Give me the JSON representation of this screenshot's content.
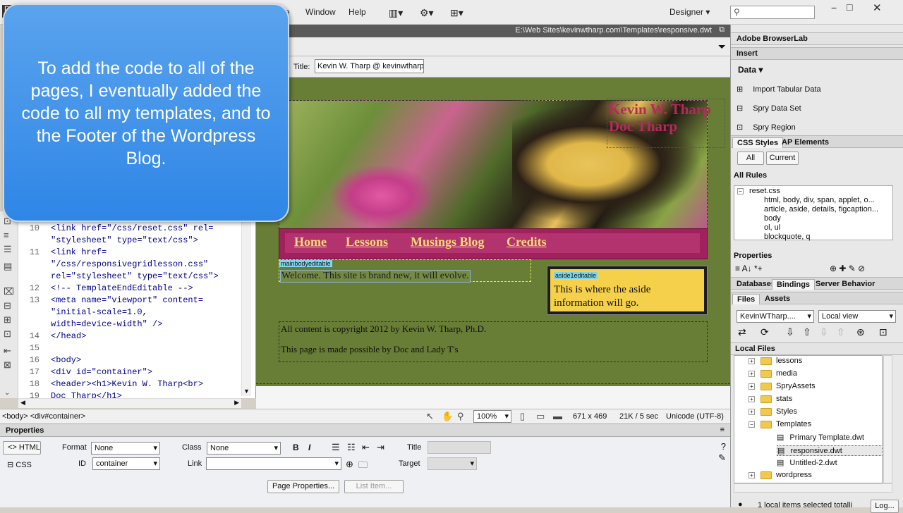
{
  "menubar": {
    "items": [
      "ite",
      "Window",
      "Help"
    ],
    "workspace": "Designer",
    "search_placeholder": ""
  },
  "document": {
    "path": "E:\\Web Sites\\kevinwtharp.com\\Templates\\responsive.dwt",
    "title_label": "Title:",
    "title_value": "Kevin W. Tharp @ kevinwtharp"
  },
  "callout": {
    "text": "To add the code to all of the pages, I eventually added the code to all my templates, and to the Footer of the Wordpress Blog."
  },
  "code": {
    "lines": [
      "10",
      "",
      "11",
      "",
      "",
      "12",
      "13",
      "",
      "",
      "14",
      "15",
      "16",
      "17",
      "18",
      "19"
    ],
    "text": "<link href=\"/css/reset.css\" rel=\n\"stylesheet\" type=\"text/css\">\n<link href=\n\"/css/responsivegridlesson.css\"\nrel=\"stylesheet\" type=\"text/css\">\n<!-- TemplateEndEditable -->\n<meta name=\"viewport\" content=\n\"initial-scale=1.0,\nwidth=device-width\" />\n</head>\n\n<body>\n<div id=\"container\">\n<header><h1>Kevin W. Tharp<br>\nDoc Tharp</h1>"
  },
  "site": {
    "heading_line1": "Kevin W. Tharp",
    "heading_line2": "Doc Tharp",
    "nav": [
      "Home",
      "Lessons",
      "Musings Blog",
      "Credits"
    ],
    "main_tag": "mainbodyeditable",
    "main_text": "Welcome. This site is brand new, it will evolve.",
    "aside_tag": "aside1editable",
    "aside_text": "This is where the aside information will go.",
    "footer_line1": "All content is copyright 2012 by Kevin W. Tharp, Ph.D.",
    "footer_line2": "This page is made possible by Doc and Lady T's"
  },
  "statusbar": {
    "tag_selector": "<body> <div#container>",
    "zoom": "100%",
    "dimensions": "671 x 469",
    "size_time": "21K / 5 sec",
    "encoding": "Unicode (UTF-8)"
  },
  "properties": {
    "title": "Properties",
    "html_tab": "HTML",
    "css_tab": "CSS",
    "format_label": "Format",
    "format_value": "None",
    "class_label": "Class",
    "class_value": "None",
    "id_label": "ID",
    "id_value": "container",
    "link_label": "Link",
    "title_label": "Title",
    "target_label": "Target",
    "page_properties": "Page Properties...",
    "list_item": "List Item..."
  },
  "right_panel": {
    "browserlab": "Adobe BrowserLab",
    "insert": "Insert",
    "insert_category": "Data",
    "insert_items": [
      "Import Tabular Data",
      "Spry Data Set",
      "Spry Region"
    ],
    "css_styles_tab": "CSS Styles",
    "ap_elements_tab": "AP Elements",
    "all_btn": "All",
    "current_btn": "Current",
    "all_rules": "All Rules",
    "rules": [
      "reset.css",
      "html, body, div, span, applet, o...",
      "article, aside, details, figcaption...",
      "body",
      "ol, ul",
      "blockquote, q"
    ],
    "properties_header": "Properties",
    "databases_tab": "Databases",
    "bindings_tab": "Bindings",
    "server_behaviors_tab": "Server Behavior",
    "files_tab": "Files",
    "assets_tab": "Assets",
    "site_select": "KevinWTharp....",
    "view_select": "Local view",
    "local_files": "Local Files",
    "files": [
      "lessons",
      "media",
      "SpryAssets",
      "stats",
      "Styles",
      "Templates",
      "Primary Template.dwt",
      "responsive.dwt",
      "Untitled-2.dwt",
      "wordpress"
    ],
    "status": "1 local items selected totalli",
    "log_btn": "Log..."
  },
  "colors": {
    "design_bg": "#687d35",
    "nav_bg": "#a1215e",
    "aside_bg": "#f5d04a",
    "callout": "#3d8fe8"
  }
}
